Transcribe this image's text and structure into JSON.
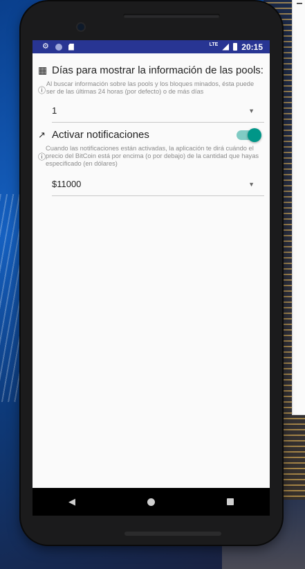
{
  "status_bar": {
    "left_icons": [
      "gear-icon",
      "circle-icon",
      "sd-card-icon"
    ],
    "network_label": "LTE",
    "time": "20:15"
  },
  "prefs": {
    "days": {
      "title": "Días para mostrar la información de las pools:",
      "summary": "Al buscar información sobre las pools y los bloques minados, ésta puede ser de las últimas 24 horas (por defecto) o de más días",
      "value": "1"
    },
    "notifications": {
      "title": "Activar notificaciones",
      "enabled": true,
      "summary": "Cuando las notificaciones están activadas, la aplicación te dirá cuándo el precio del BitCoin está por encima (o por debajo) de la cantidad que hayas especificado (en dólares)",
      "value": "$11000"
    }
  },
  "nav_bar": [
    "back-icon",
    "home-icon",
    "recents-icon"
  ],
  "colors": {
    "status_bar": "#283593",
    "accent": "#009688",
    "accent_track": "#80cbc4"
  }
}
